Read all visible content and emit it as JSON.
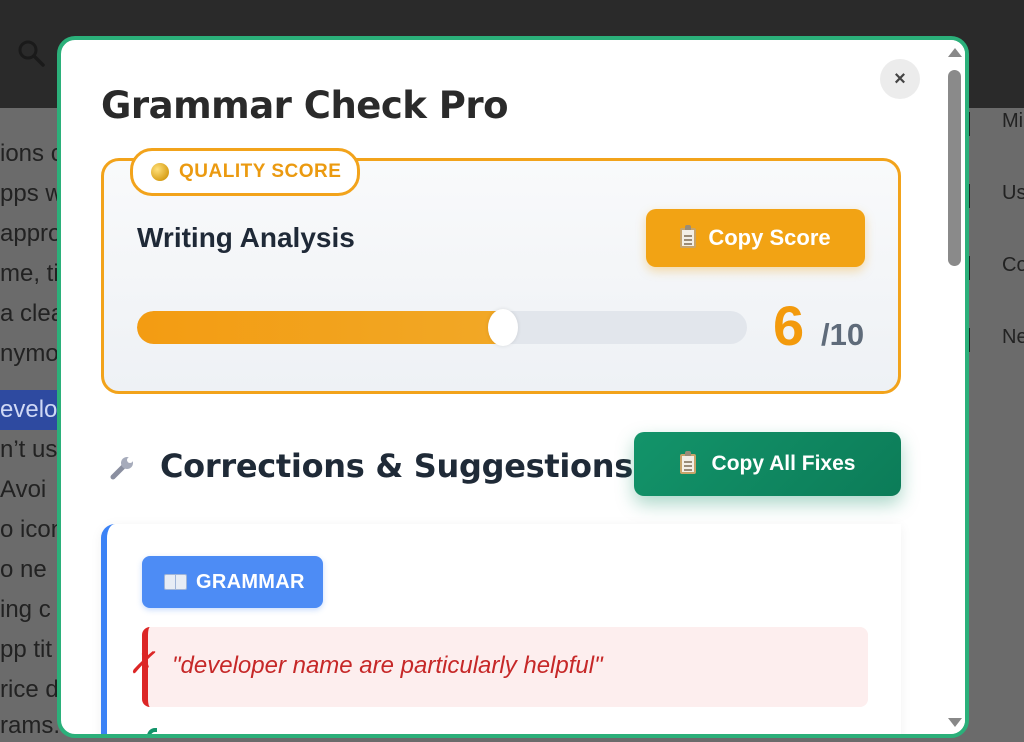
{
  "background": {
    "left_lines": [
      "ions c",
      "pps w",
      "appro",
      "me, ti",
      "a clea",
      "nymo",
      "n’t use",
      "Avoi",
      "o icon",
      "o ne",
      "ing c",
      "pp tit",
      "rice d",
      "rams."
    ],
    "highlight_text": "evelo",
    "right_items": [
      "Mi",
      "Us",
      "Co",
      "Ne"
    ]
  },
  "modal": {
    "title": "Grammar Check Pro",
    "close_label": "×",
    "score_card": {
      "badge_label": "QUALITY SCORE",
      "heading": "Writing Analysis",
      "copy_button_label": "Copy Score",
      "score": "6",
      "score_max": "/10",
      "progress_fraction": 0.6
    },
    "corrections": {
      "title": "Corrections & Suggestions:",
      "copy_all_label": "Copy All Fixes",
      "items": [
        {
          "tag": "GRAMMAR",
          "original": "\"developer name are particularly helpful\""
        }
      ]
    }
  },
  "colors": {
    "accent_green": "#2bb07a",
    "score_orange": "#f2a31b",
    "grammar_blue": "#4d8cf5",
    "error_red": "#dc2626"
  },
  "icons": [
    "search-icon",
    "close-icon",
    "coin-icon",
    "clipboard-icon",
    "wrench-icon",
    "book-icon",
    "cross-icon"
  ]
}
